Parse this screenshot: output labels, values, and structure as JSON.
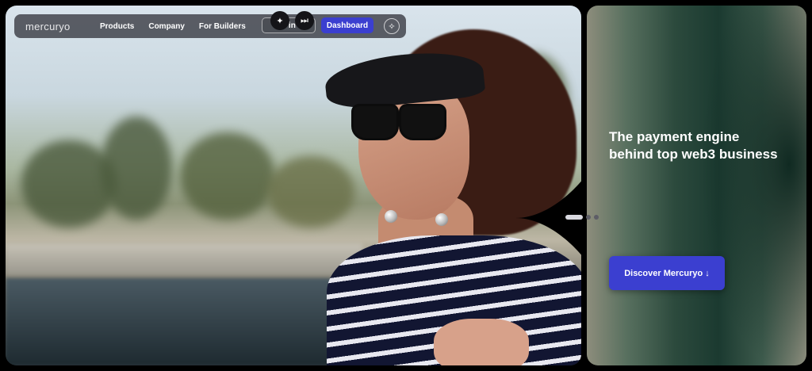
{
  "nav": {
    "logo": "mercuryo",
    "links": [
      "Products",
      "Company",
      "For Builders"
    ],
    "login_label": "L  in",
    "dashboard_label": "Dashboard",
    "controls": {
      "ai_icon": "sparkles-icon",
      "skip_icon": "skip-next-icon",
      "theme_icon": "sparkle-star-icon"
    }
  },
  "hero": {
    "headline": "The payment engine behind top web3 business",
    "cta_label": "Discover Mercuryo ↓"
  },
  "carousel": {
    "slides": 3,
    "active": 1
  },
  "colors": {
    "accent": "#3b3fd0",
    "background": "#000000",
    "panel_green": "#1b3a30"
  }
}
